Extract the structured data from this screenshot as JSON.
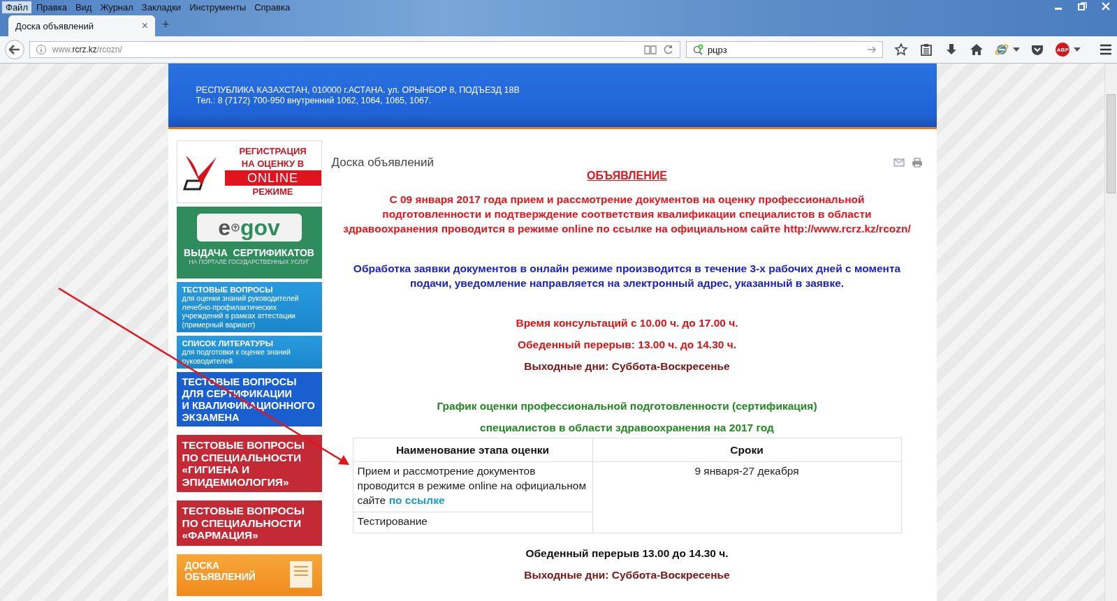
{
  "menu": [
    {
      "label": "Файл",
      "selected": true
    },
    {
      "label": "Правка",
      "selected": false
    },
    {
      "label": "Вид",
      "selected": false
    },
    {
      "label": "Журнал",
      "selected": false
    },
    {
      "label": "Закладки",
      "selected": false
    },
    {
      "label": "Инструменты",
      "selected": false
    },
    {
      "label": "Справка",
      "selected": false
    }
  ],
  "tabs": [
    {
      "title": "Доска объявлений",
      "close": "×",
      "selected": true
    }
  ],
  "new_tab": "+",
  "address_bar": {
    "prefix": "www.",
    "domain": "rcrz.kz",
    "path": "/rcozn/"
  },
  "search_bar": {
    "value": "рцрз"
  },
  "toolbar": {
    "adblock_badge": "ABP"
  },
  "header": {
    "lines": [
      "РЕСПУБЛИКА КАЗАХСТАН, 010000 г.АСТАНА. ул. ОРЫНБОР 8, ПОДЪЕЗД 18В",
      "Тел.: 8 (7172) 700-950 внутренний 1062, 1064, 1065, 1067."
    ]
  },
  "sidebar": {
    "banners": [
      {
        "kind": "register",
        "lines": [
          "РЕГИСТРАЦИЯ",
          "НА ОЦЕНКУ В"
        ],
        "highlight": "ONLINE",
        "last": "РЕЖИМЕ"
      },
      {
        "kind": "egov",
        "logo_prefix": "e",
        "logo_suffix": "gov",
        "title": "ВЫДАЧА  СЕРТИФИКАТОВ",
        "subtitle": "НА ПОРТАЛЕ ГОСУДАРСТВЕННЫХ УСЛУГ"
      },
      {
        "kind": "info",
        "title": "ТЕСТОВЫЕ ВОПРОСЫ",
        "text": "для оценки знаний руководителей лечебно-профилактических учреждений в рамках аттестации (примерный вариант)"
      },
      {
        "kind": "info",
        "title": "СПИСОК ЛИТЕРАТУРЫ",
        "text": "для подготовки к оценке знаний руководителей"
      },
      {
        "kind": "blue",
        "title": "ТЕСТОВЫЕ ВОПРОСЫ\nДЛЯ СЕРТИФИКАЦИИ\nИ КВАЛИФИКАЦИОННОГО\nЭКЗАМЕНА"
      },
      {
        "kind": "red",
        "title": "ТЕСТОВЫЕ ВОПРОСЫ\nПО СПЕЦИАЛЬНОСТИ\n«ГИГИЕНА И\nЭПИДЕМИОЛОГИЯ»"
      },
      {
        "kind": "red",
        "title": "ТЕСТОВЫЕ ВОПРОСЫ\nПО СПЕЦИАЛЬНОСТИ\n«ФАРМАЦИЯ»"
      },
      {
        "kind": "orange",
        "title": "ДОСКА\nОБЪЯВЛЕНИЙ"
      }
    ]
  },
  "article": {
    "title": "Доска объявлений",
    "heading": "ОБЪЯВЛЕНИЕ",
    "blocks": [
      [
        {
          "text": "С 09 января 2017 года прием и рассмотрение документов на оценку профессиональной\nподготовленности и подтверждение соответствия квалификации специалистов в области\nздравоохранения проводится в режиме online  по ссылке на официальном сайте http://www.rcrz.kz/rcozn/",
          "color": "#e8141a"
        }
      ],
      [
        {
          "text": "Обработка заявки документов в онлайн режиме производится в течение 3-х рабочих дней с момента подачи, уведомление направляется на электронный адрес, указанный в заявке.",
          "color": "#1a22c8"
        }
      ],
      [
        {
          "text": "Время консультаций с 10.00 ч. до 17.00 ч.",
          "color": "#d81414"
        },
        {
          "text": "Обеденный перерыв: 13.00 ч. до 14.30 ч.",
          "color": "#d81414"
        },
        {
          "text": "Выходные дни: Суббота-Воскресенье",
          "color": "#7a1212"
        }
      ],
      [
        {
          "text": "График  оценки профессиональной  подготовленности (сертификация)",
          "color": "#1f8a1f"
        },
        {
          "text": "специалистов в области здравоохранения на 2017 год",
          "color": "#1f8a1f"
        }
      ]
    ],
    "table": {
      "columns": [
        "Наименование этапа оценки",
        "Сроки"
      ],
      "rows": [
        {
          "stage": "Прием и рассмотрение документов проводится в режиме online на официальном сайте",
          "link": "по ссылке",
          "term": "9 января-27 декабря"
        },
        {
          "stage": "Тестирование"
        }
      ]
    },
    "footer": [
      {
        "text": "Обеденный перерыв 13.00  до 14.30 ч.",
        "color": "#111111"
      },
      {
        "text": "Выходные дни: Суббота-Воскресенье",
        "color": "#7a1212"
      }
    ]
  }
}
